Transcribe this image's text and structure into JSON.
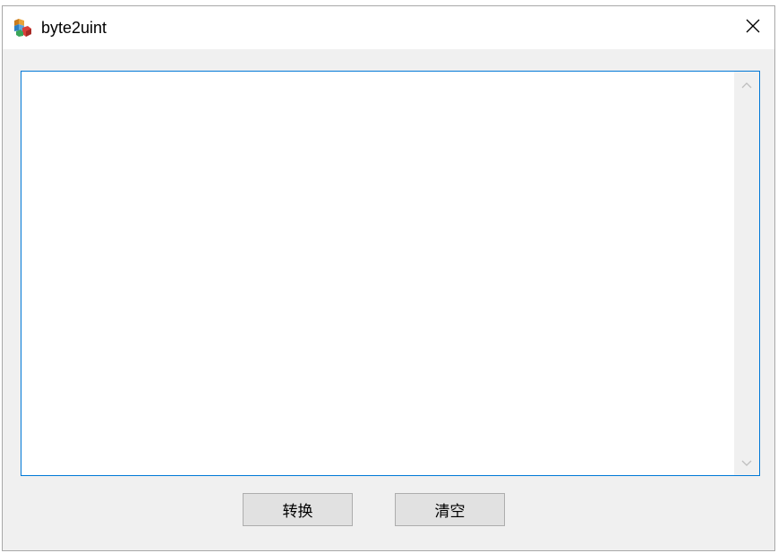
{
  "window": {
    "title": "byte2uint",
    "app_icon": "app-cubes-icon",
    "close_icon": "close-icon"
  },
  "editor": {
    "value": "",
    "placeholder": "",
    "scroll_up_icon": "chevron-up-icon",
    "scroll_down_icon": "chevron-down-icon"
  },
  "buttons": {
    "convert_label": "转换",
    "clear_label": "清空"
  },
  "colors": {
    "window_bg": "#f0f0f0",
    "titlebar_bg": "#ffffff",
    "focus_border": "#0078d7",
    "button_bg": "#e1e1e1",
    "button_border": "#adadad"
  }
}
